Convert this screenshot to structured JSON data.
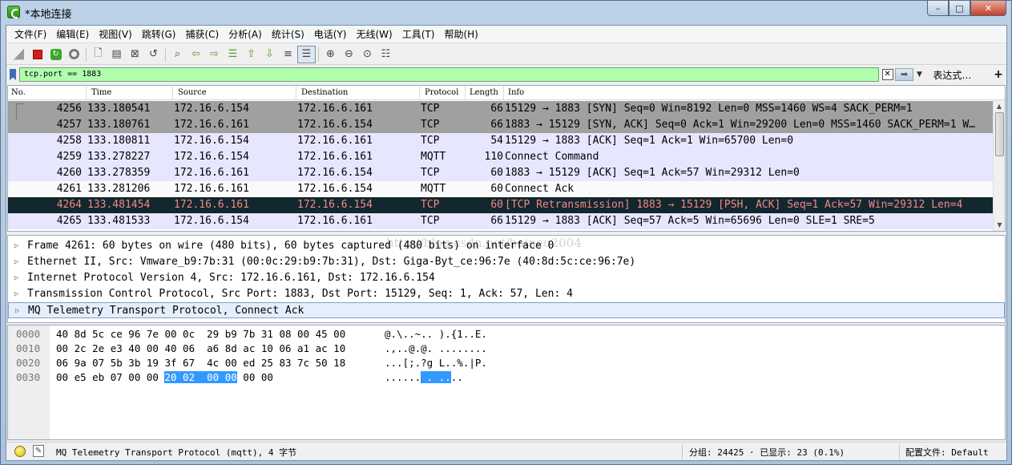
{
  "window": {
    "title": "*本地连接"
  },
  "menu": [
    "文件(F)",
    "编辑(E)",
    "视图(V)",
    "跳转(G)",
    "捕获(C)",
    "分析(A)",
    "统计(S)",
    "电话(Y)",
    "无线(W)",
    "工具(T)",
    "帮助(H)"
  ],
  "toolbar": {
    "icons": [
      "shark-fin-icon",
      "stop-icon",
      "restart-icon",
      "capture-options-icon",
      "open-file-icon",
      "save-file-icon",
      "close-file-icon",
      "reload-icon",
      "find-packet-icon",
      "go-back-icon",
      "go-forward-icon",
      "go-to-packet-icon",
      "go-first-icon",
      "go-last-icon",
      "autoscroll-icon",
      "colorize-icon",
      "zoom-in-icon",
      "zoom-out-icon",
      "zoom-normal-icon",
      "resize-columns-icon"
    ]
  },
  "filter": {
    "value": "tcp.port == 1883",
    "expression_label": "表达式…",
    "plus": "+"
  },
  "packet_list": {
    "columns": [
      "No.",
      "Time",
      "Source",
      "Destination",
      "Protocol",
      "Length",
      "Info"
    ],
    "rows": [
      {
        "no": "4256",
        "time": "133.180541",
        "src": "172.16.6.154",
        "dst": "172.16.6.161",
        "proto": "TCP",
        "len": "66",
        "info": "15129 → 1883 [SYN] Seq=0 Win=8192 Len=0 MSS=1460 WS=4 SACK_PERM=1",
        "style": "gray"
      },
      {
        "no": "4257",
        "time": "133.180761",
        "src": "172.16.6.161",
        "dst": "172.16.6.154",
        "proto": "TCP",
        "len": "66",
        "info": "1883 → 15129 [SYN, ACK] Seq=0 Ack=1 Win=29200 Len=0 MSS=1460 SACK_PERM=1 W…",
        "style": "gray"
      },
      {
        "no": "4258",
        "time": "133.180811",
        "src": "172.16.6.154",
        "dst": "172.16.6.161",
        "proto": "TCP",
        "len": "54",
        "info": "15129 → 1883 [ACK] Seq=1 Ack=1 Win=65700 Len=0",
        "style": "lav"
      },
      {
        "no": "4259",
        "time": "133.278227",
        "src": "172.16.6.154",
        "dst": "172.16.6.161",
        "proto": "MQTT",
        "len": "110",
        "info": "Connect Command",
        "style": "lav"
      },
      {
        "no": "4260",
        "time": "133.278359",
        "src": "172.16.6.161",
        "dst": "172.16.6.154",
        "proto": "TCP",
        "len": "60",
        "info": "1883 → 15129 [ACK] Seq=1 Ack=57 Win=29312 Len=0",
        "style": "lav"
      },
      {
        "no": "4261",
        "time": "133.281206",
        "src": "172.16.6.161",
        "dst": "172.16.6.154",
        "proto": "MQTT",
        "len": "60",
        "info": "Connect Ack",
        "style": "white"
      },
      {
        "no": "4264",
        "time": "133.481454",
        "src": "172.16.6.161",
        "dst": "172.16.6.154",
        "proto": "TCP",
        "len": "60",
        "info": "[TCP Retransmission] 1883 → 15129 [PSH, ACK] Seq=1 Ack=57 Win=29312 Len=4",
        "style": "dark"
      },
      {
        "no": "4265",
        "time": "133.481533",
        "src": "172.16.6.154",
        "dst": "172.16.6.161",
        "proto": "TCP",
        "len": "66",
        "info": "15129 → 1883 [ACK] Seq=57 Ack=5 Win=65696 Len=0 SLE=1 SRE=5",
        "style": "lav"
      }
    ]
  },
  "details": {
    "watermark": "http://blog.csdn.net/baineu2004",
    "rows": [
      "Frame 4261: 60 bytes on wire (480 bits), 60 bytes captured (480 bits) on interface 0",
      "Ethernet II, Src: Vmware_b9:7b:31 (00:0c:29:b9:7b:31), Dst: Giga-Byt_ce:96:7e (40:8d:5c:ce:96:7e)",
      "Internet Protocol Version 4, Src: 172.16.6.161, Dst: 172.16.6.154",
      "Transmission Control Protocol, Src Port: 1883, Dst Port: 15129, Seq: 1, Ack: 57, Len: 4",
      "MQ Telemetry Transport Protocol, Connect Ack"
    ]
  },
  "bytes": {
    "rows": [
      {
        "off": "0000",
        "hex_pre": "40 8d 5c ce 96 7e 00 0c  29 b9 7b 31 08 00 45 00",
        "hex_hl": "",
        "hex_post": "",
        "asc_pre": "@.\\..~.. ).{1..E.",
        "asc_hl": "",
        "asc_post": ""
      },
      {
        "off": "0010",
        "hex_pre": "00 2c 2e e3 40 00 40 06  a6 8d ac 10 06 a1 ac 10",
        "hex_hl": "",
        "hex_post": "",
        "asc_pre": ".,..@.@. ........",
        "asc_hl": "",
        "asc_post": ""
      },
      {
        "off": "0020",
        "hex_pre": "06 9a 07 5b 3b 19 3f 67  4c 00 ed 25 83 7c 50 18",
        "hex_hl": "",
        "hex_post": "",
        "asc_pre": "...[;.?g L..%.|P.",
        "asc_hl": "",
        "asc_post": ""
      },
      {
        "off": "0030",
        "hex_pre": "00 e5 eb 07 00 00 ",
        "hex_hl": "20 02  00 00",
        "hex_post": " 00 00",
        "asc_pre": "......",
        "asc_hl": " . ..",
        "asc_post": ".."
      }
    ]
  },
  "status": {
    "main": "MQ Telemetry Transport Protocol (mqtt), 4 字节",
    "counts": "分组: 24425 · 已显示: 23 (0.1%)",
    "profile": "配置文件: Default"
  }
}
